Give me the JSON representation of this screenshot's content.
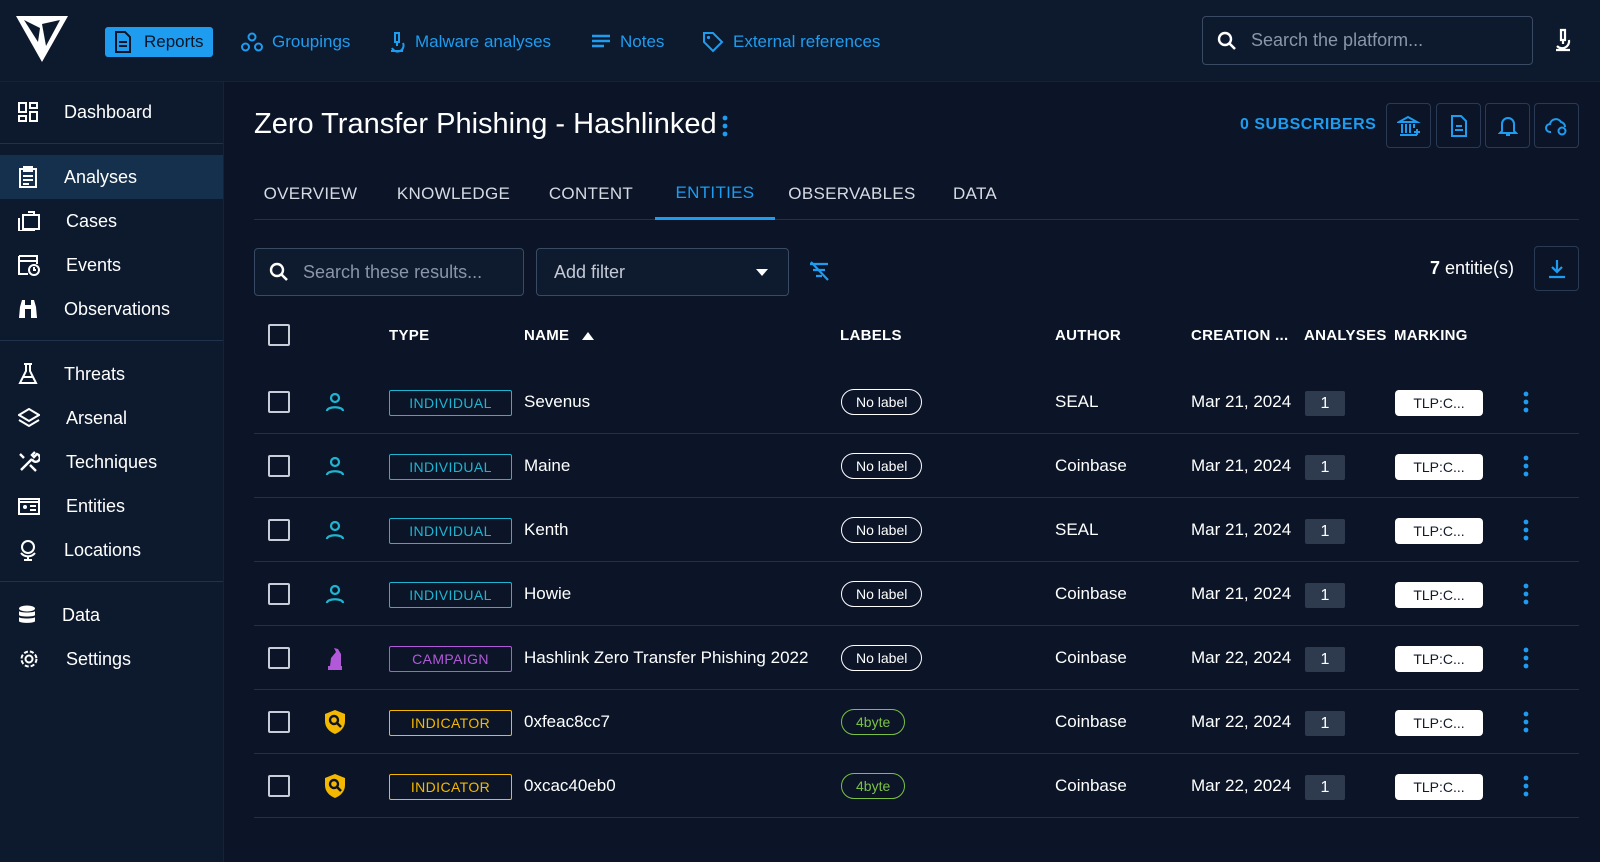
{
  "topnav": {
    "items": [
      {
        "label": "Reports",
        "icon": "report-icon",
        "active": true
      },
      {
        "label": "Groupings",
        "icon": "groupings-icon"
      },
      {
        "label": "Malware analyses",
        "icon": "microscope-icon"
      },
      {
        "label": "Notes",
        "icon": "notes-icon"
      },
      {
        "label": "External references",
        "icon": "tag-icon"
      }
    ],
    "search_placeholder": "Search the platform..."
  },
  "sidebar": {
    "items": [
      {
        "label": "Dashboard",
        "icon": "dashboard-icon"
      },
      {
        "label": "Analyses",
        "icon": "analyses-icon",
        "active": true
      },
      {
        "label": "Cases",
        "icon": "cases-icon"
      },
      {
        "label": "Events",
        "icon": "events-icon"
      },
      {
        "label": "Observations",
        "icon": "binoculars-icon"
      },
      {
        "label": "Threats",
        "icon": "flask-icon"
      },
      {
        "label": "Arsenal",
        "icon": "layers-icon"
      },
      {
        "label": "Techniques",
        "icon": "tools-icon"
      },
      {
        "label": "Entities",
        "icon": "entities-icon"
      },
      {
        "label": "Locations",
        "icon": "globe-icon"
      },
      {
        "label": "Data",
        "icon": "database-icon"
      },
      {
        "label": "Settings",
        "icon": "gear-icon"
      }
    ]
  },
  "header": {
    "title": "Zero Transfer Phishing - Hashlinked",
    "subscribers": "0 SUBSCRIBERS"
  },
  "tabs": [
    "OVERVIEW",
    "KNOWLEDGE",
    "CONTENT",
    "ENTITIES",
    "OBSERVABLES",
    "DATA"
  ],
  "active_tab": "ENTITIES",
  "filters": {
    "search_placeholder": "Search these results...",
    "add_filter_label": "Add filter"
  },
  "count": {
    "number": "7",
    "suffix": " entitie(s)"
  },
  "table": {
    "columns": [
      "TYPE",
      "NAME",
      "LABELS",
      "AUTHOR",
      "CREATION ...",
      "ANALYSES",
      "MARKING"
    ],
    "rows": [
      {
        "type": "INDIVIDUAL",
        "name": "Sevenus",
        "label": "No label",
        "author": "SEAL",
        "created": "Mar 21, 2024",
        "analyses": "1",
        "marking": "TLP:C..."
      },
      {
        "type": "INDIVIDUAL",
        "name": "Maine",
        "label": "No label",
        "author": "Coinbase",
        "created": "Mar 21, 2024",
        "analyses": "1",
        "marking": "TLP:C..."
      },
      {
        "type": "INDIVIDUAL",
        "name": "Kenth",
        "label": "No label",
        "author": "SEAL",
        "created": "Mar 21, 2024",
        "analyses": "1",
        "marking": "TLP:C..."
      },
      {
        "type": "INDIVIDUAL",
        "name": "Howie",
        "label": "No label",
        "author": "Coinbase",
        "created": "Mar 21, 2024",
        "analyses": "1",
        "marking": "TLP:C..."
      },
      {
        "type": "CAMPAIGN",
        "name": "Hashlink Zero Transfer Phishing 2022",
        "label": "No label",
        "author": "Coinbase",
        "created": "Mar 22, 2024",
        "analyses": "1",
        "marking": "TLP:C..."
      },
      {
        "type": "INDICATOR",
        "name": "0xfeac8cc7",
        "label": "4byte",
        "author": "Coinbase",
        "created": "Mar 22, 2024",
        "analyses": "1",
        "marking": "TLP:C..."
      },
      {
        "type": "INDICATOR",
        "name": "0xcac40eb0",
        "label": "4byte",
        "author": "Coinbase",
        "created": "Mar 22, 2024",
        "analyses": "1",
        "marking": "TLP:C..."
      }
    ]
  },
  "colors": {
    "accent": "#1e9cf0",
    "individual": "#1fb4d1",
    "campaign": "#b259d9",
    "indicator": "#f5b800",
    "label_4byte": "#7ac143",
    "background": "#0b1527"
  }
}
